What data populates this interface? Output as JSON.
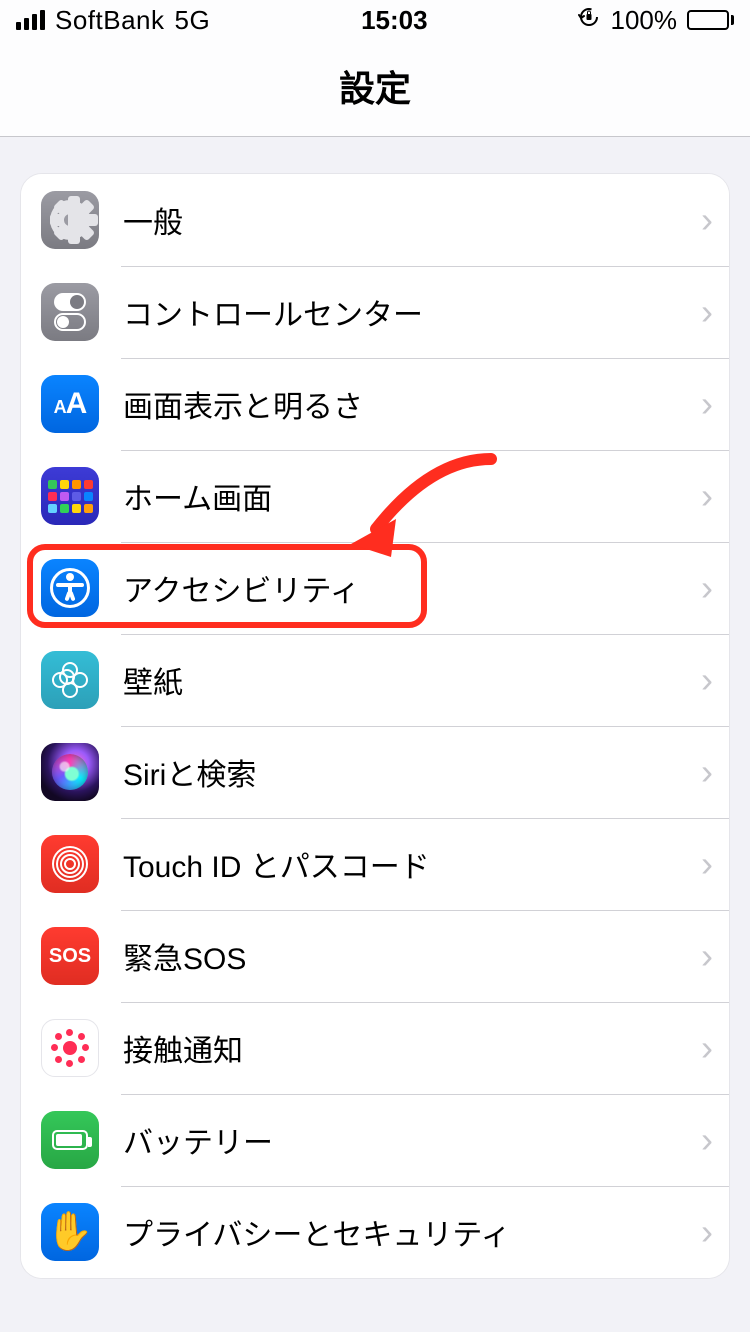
{
  "statusbar": {
    "carrier": "SoftBank",
    "network": "5G",
    "time": "15:03",
    "lock_glyph": "⟳",
    "battery_pct": "100%"
  },
  "header": {
    "title": "設定"
  },
  "items": [
    {
      "key": "general",
      "label": "一般"
    },
    {
      "key": "control-center",
      "label": "コントロールセンター"
    },
    {
      "key": "display",
      "label": "画面表示と明るさ"
    },
    {
      "key": "home-screen",
      "label": "ホーム画面"
    },
    {
      "key": "accessibility",
      "label": "アクセシビリティ"
    },
    {
      "key": "wallpaper",
      "label": "壁紙"
    },
    {
      "key": "siri",
      "label": "Siriと検索"
    },
    {
      "key": "touchid",
      "label": "Touch ID とパスコード"
    },
    {
      "key": "sos",
      "label": "緊急SOS",
      "icon_text": "SOS"
    },
    {
      "key": "exposure",
      "label": "接触通知"
    },
    {
      "key": "battery",
      "label": "バッテリー"
    },
    {
      "key": "privacy",
      "label": "プライバシーとセキュリティ"
    }
  ],
  "annotation": {
    "highlight_item_key": "accessibility",
    "arrow_target_item_key": "accessibility"
  }
}
